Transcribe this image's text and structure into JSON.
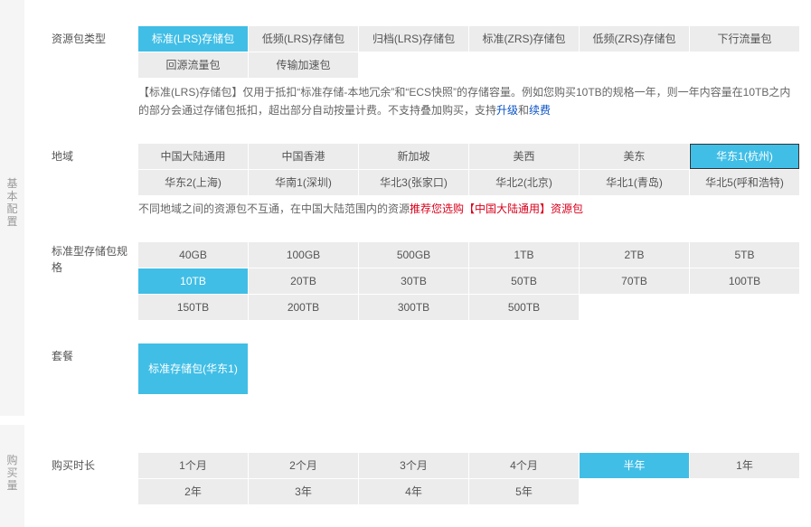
{
  "basic_section": {
    "side_label": [
      "基",
      "本",
      "配",
      "置"
    ],
    "package_type": {
      "label": "资源包类型",
      "options": [
        "标准(LRS)存储包",
        "低频(LRS)存储包",
        "归档(LRS)存储包",
        "标准(ZRS)存储包",
        "低频(ZRS)存储包",
        "下行流量包",
        "回源流量包",
        "传输加速包"
      ],
      "selected": "标准(LRS)存储包",
      "note_line1": "【标准(LRS)存储包】仅用于抵扣“标准存储-本地冗余”和“ECS快照”的存储容量。例如您购买10TB的规格一年，则一年内容量在10TB之内",
      "note_line2_prefix": "的部分会通过存储包抵扣，超出部分自动按量计费。不支持叠加购买，支持",
      "note_link_upgrade": "升级",
      "note_and": "和",
      "note_link_renew": "续费"
    },
    "region": {
      "label": "地域",
      "options": [
        "中国大陆通用",
        "中国香港",
        "新加坡",
        "美西",
        "美东",
        "华东1(杭州)",
        "华东2(上海)",
        "华南1(深圳)",
        "华北3(张家口)",
        "华北2(北京)",
        "华北1(青岛)",
        "华北5(呼和浩特)"
      ],
      "selected": "华东1(杭州)",
      "note_prefix": "不同地域之间的资源包不互通，在中国大陆范围内的资源",
      "note_highlight": "推荐您选购【中国大陆通用】资源包"
    },
    "spec": {
      "label_line1": "标准型存储包规",
      "label_line2": "格",
      "options": [
        "40GB",
        "100GB",
        "500GB",
        "1TB",
        "2TB",
        "5TB",
        "10TB",
        "20TB",
        "30TB",
        "50TB",
        "70TB",
        "100TB",
        "150TB",
        "200TB",
        "300TB",
        "500TB"
      ],
      "selected": "10TB"
    },
    "plan": {
      "label": "套餐",
      "value": "标准存储包(华东1)"
    }
  },
  "purchase_section": {
    "side_label": [
      "购",
      "买",
      "量"
    ],
    "duration": {
      "label": "购买时长",
      "options": [
        "1个月",
        "2个月",
        "3个月",
        "4个月",
        "半年",
        "1年",
        "2年",
        "3年",
        "4年",
        "5年"
      ],
      "selected": "半年"
    }
  },
  "colors": {
    "accent": "#40bee6",
    "option_bg": "#ececec",
    "link": "#0a53c5",
    "highlight_red": "#d9001b"
  }
}
